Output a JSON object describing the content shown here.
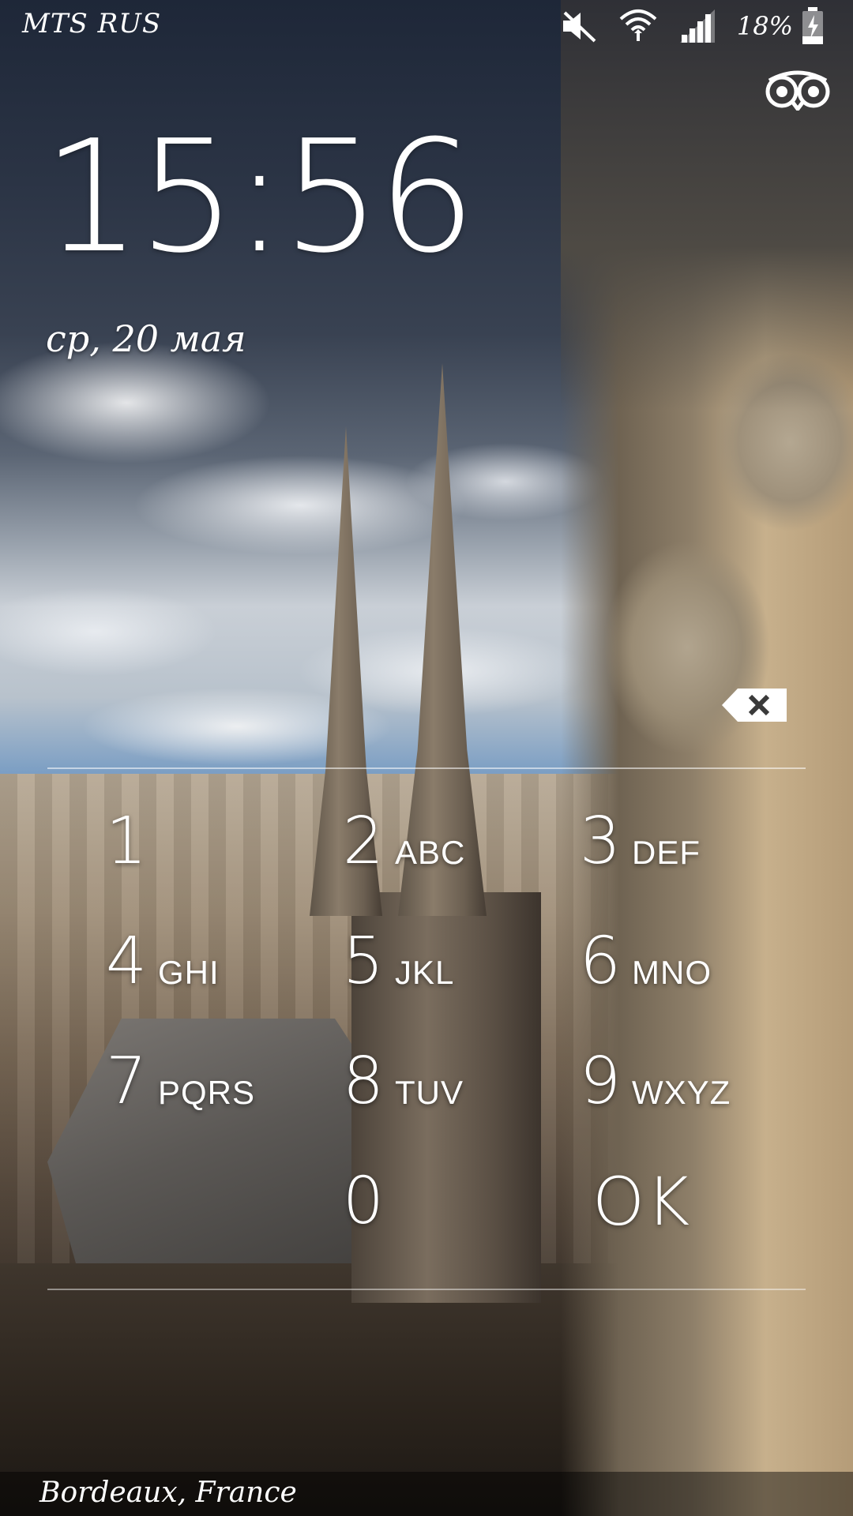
{
  "status_bar": {
    "carrier": "MTS RUS",
    "battery_percent": "18%",
    "icons": [
      "muted-sound-icon",
      "wifi-icon",
      "signal-icon",
      "battery-charging-icon"
    ]
  },
  "app_shortcut": {
    "icon": "tripadvisor-owl-icon"
  },
  "lockscreen": {
    "time": "15:56",
    "date": "ср, 20 мая"
  },
  "pin_entry": {
    "backspace_icon": "backspace-icon"
  },
  "keypad": {
    "keys": [
      {
        "digit": "1",
        "letters": ""
      },
      {
        "digit": "2",
        "letters": "ABC"
      },
      {
        "digit": "3",
        "letters": "DEF"
      },
      {
        "digit": "4",
        "letters": "GHI"
      },
      {
        "digit": "5",
        "letters": "JKL"
      },
      {
        "digit": "6",
        "letters": "MNO"
      },
      {
        "digit": "7",
        "letters": "PQRS"
      },
      {
        "digit": "8",
        "letters": "TUV"
      },
      {
        "digit": "9",
        "letters": "WXYZ"
      },
      {
        "digit": "",
        "letters": ""
      },
      {
        "digit": "0",
        "letters": ""
      },
      {
        "digit": "OK",
        "letters": ""
      }
    ]
  },
  "wallpaper": {
    "location": "Bordeaux, France"
  }
}
